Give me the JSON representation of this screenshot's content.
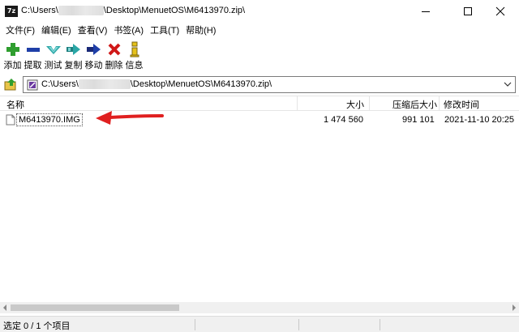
{
  "window": {
    "app_icon_text": "7z",
    "title_prefix": "C:\\Users\\",
    "title_suffix": "\\Desktop\\MenuetOS\\M6413970.zip\\"
  },
  "menu": [
    {
      "label": "文件(F)"
    },
    {
      "label": "编辑(E)"
    },
    {
      "label": "查看(V)"
    },
    {
      "label": "书签(A)"
    },
    {
      "label": "工具(T)"
    },
    {
      "label": "帮助(H)"
    }
  ],
  "toolbar": {
    "add": "添加",
    "extract": "提取",
    "test": "测试",
    "copy": "复制",
    "move": "移动",
    "delete": "删除",
    "info": "信息"
  },
  "address": {
    "prefix": "C:\\Users\\",
    "suffix": "\\Desktop\\MenuetOS\\M6413970.zip\\"
  },
  "columns": {
    "name": "名称",
    "size": "大小",
    "packed": "压缩后大小",
    "modified": "修改时间"
  },
  "files": [
    {
      "name": "M6413970.IMG",
      "size": "1 474 560",
      "packed": "991 101",
      "modified": "2021-11-10 20:25"
    }
  ],
  "status": {
    "selection": "选定 0 / 1 个项目"
  },
  "colors": {
    "arrow": "#e02020",
    "add_green": "#2f9e2f",
    "extract_blue": "#1f3fa8",
    "test_teal": "#2aa6a6",
    "delete_red": "#d01818",
    "info_yellow": "#e6c21a"
  }
}
